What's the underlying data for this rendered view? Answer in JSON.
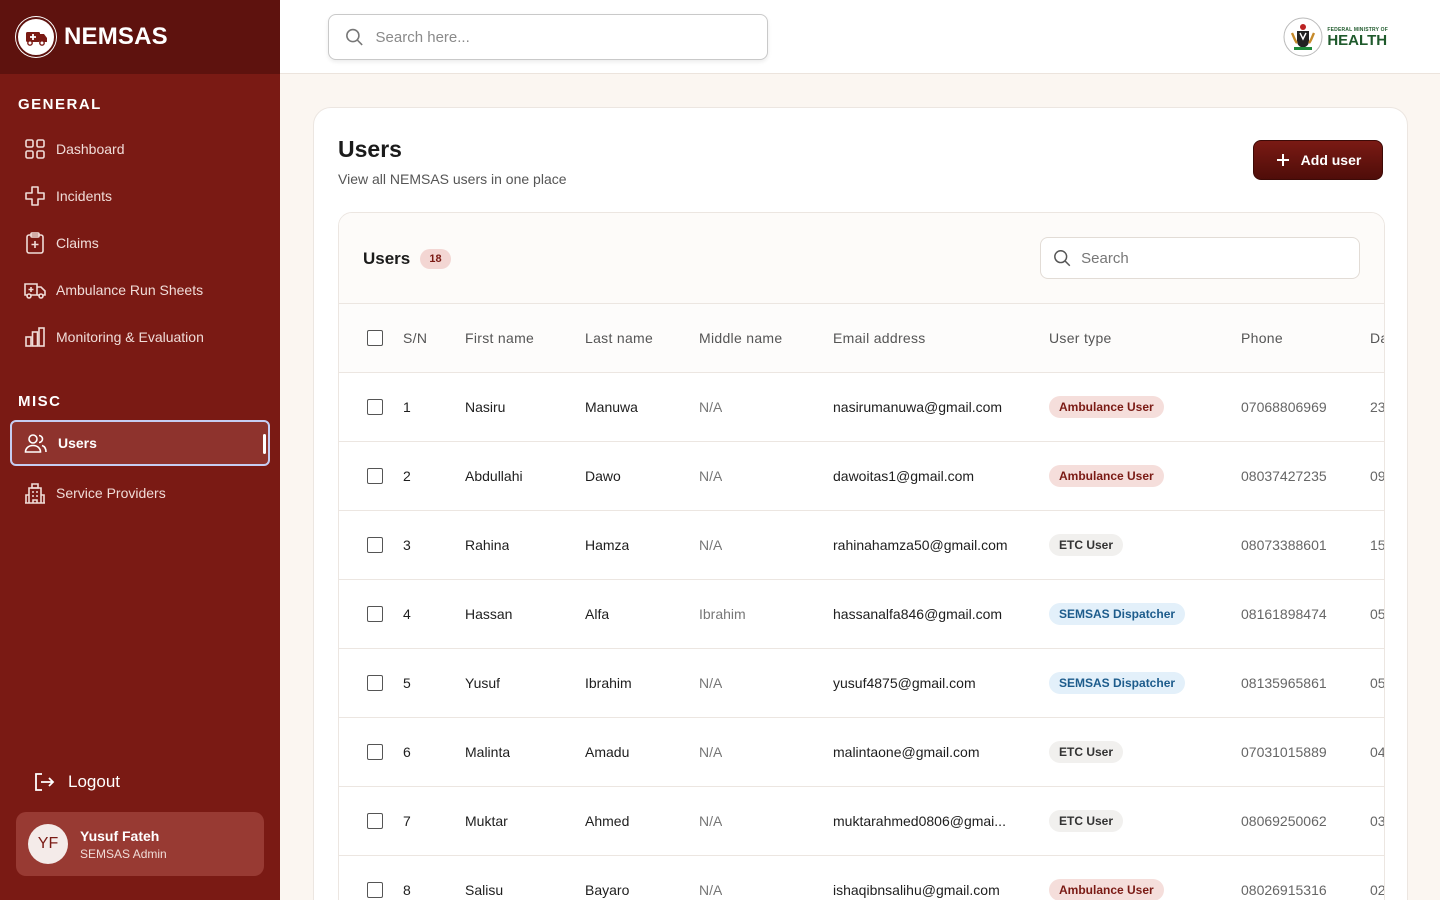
{
  "app": {
    "name": "NEMSAS"
  },
  "sidebar": {
    "general_label": "GENERAL",
    "misc_label": "MISC",
    "general_items": [
      {
        "label": "Dashboard",
        "icon": "grid-icon"
      },
      {
        "label": "Incidents",
        "icon": "medical-cross-icon"
      },
      {
        "label": "Claims",
        "icon": "clipboard-plus-icon"
      },
      {
        "label": "Ambulance Run Sheets",
        "icon": "ambulance-icon"
      },
      {
        "label": "Monitoring & Evaluation",
        "icon": "bar-chart-icon"
      }
    ],
    "misc_items": [
      {
        "label": "Users",
        "icon": "users-icon",
        "active": true
      },
      {
        "label": "Service Providers",
        "icon": "building-icon"
      }
    ],
    "logout_label": "Logout",
    "profile": {
      "initials": "YF",
      "name": "Yusuf Fateh",
      "role": "SEMSAS Admin"
    }
  },
  "header": {
    "search_placeholder": "Search here...",
    "ministry_small": "FEDERAL MINISTRY OF",
    "ministry_big": "HEALTH"
  },
  "main": {
    "title": "Users",
    "subtitle": "View all NEMSAS users in one place",
    "add_button_label": "Add user",
    "table_title": "Users",
    "user_count": "18",
    "table_search_placeholder": "Search",
    "columns": [
      "S/N",
      "First name",
      "Last name",
      "Middle name",
      "Email address",
      "User type",
      "Phone",
      "Da"
    ],
    "rows": [
      {
        "sn": "1",
        "first": "Nasiru",
        "last": "Manuwa",
        "middle": "N/A",
        "email": "nasirumanuwa@gmail.com",
        "type": "Ambulance User",
        "phone": "07068806969",
        "date": "23"
      },
      {
        "sn": "2",
        "first": "Abdullahi",
        "last": "Dawo",
        "middle": "N/A",
        "email": "dawoitas1@gmail.com",
        "type": "Ambulance User",
        "phone": "08037427235",
        "date": "09"
      },
      {
        "sn": "3",
        "first": "Rahina",
        "last": "Hamza",
        "middle": "N/A",
        "email": "rahinahamza50@gmail.com",
        "type": "ETC User",
        "phone": "08073388601",
        "date": "15"
      },
      {
        "sn": "4",
        "first": "Hassan",
        "last": "Alfa",
        "middle": "Ibrahim",
        "email": "hassanalfa846@gmail.com",
        "type": "SEMSAS Dispatcher",
        "phone": "08161898474",
        "date": "05"
      },
      {
        "sn": "5",
        "first": "Yusuf",
        "last": "Ibrahim",
        "middle": "N/A",
        "email": "yusuf4875@gmail.com",
        "type": "SEMSAS Dispatcher",
        "phone": "08135965861",
        "date": "05"
      },
      {
        "sn": "6",
        "first": "Malinta",
        "last": "Amadu",
        "middle": "N/A",
        "email": "malintaone@gmail.com",
        "type": "ETC User",
        "phone": "07031015889",
        "date": "04"
      },
      {
        "sn": "7",
        "first": "Muktar",
        "last": "Ahmed",
        "middle": "N/A",
        "email": "muktarahmed0806@gmai...",
        "type": "ETC User",
        "phone": "08069250062",
        "date": "03"
      },
      {
        "sn": "8",
        "first": "Salisu",
        "last": "Bayaro",
        "middle": "N/A",
        "email": "ishaqibnsalihu@gmail.com",
        "type": "Ambulance User",
        "phone": "08026915316",
        "date": "02"
      }
    ]
  },
  "colors": {
    "sidebar": "#7a1a14",
    "brand_bar": "#5e120e",
    "accent": "#7a1a14",
    "health_green": "#1f5a2c"
  }
}
